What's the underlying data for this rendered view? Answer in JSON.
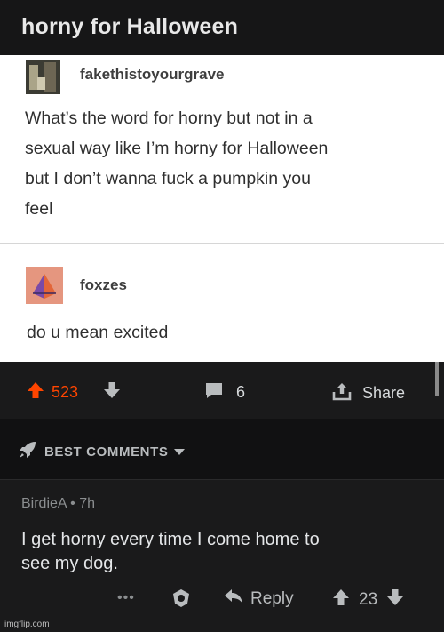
{
  "post": {
    "title": "horny for Halloween"
  },
  "tumblr": {
    "post1": {
      "username": "fakethistoyourgrave",
      "text_lines": [
        "What’s the word for horny but not in a",
        "sexual way like I’m horny for Halloween",
        "but I don’t wanna fuck a pumpkin you",
        "feel"
      ]
    },
    "post2": {
      "username": "foxzes",
      "text": "do u mean excited"
    }
  },
  "actionbar": {
    "upvotes": "523",
    "comments": "6",
    "share_label": "Share"
  },
  "sort": {
    "label": "BEST COMMENTS"
  },
  "comment": {
    "meta": "BirdieA • 7h",
    "text_lines": [
      "I get horny every time I come home to",
      "see my dog."
    ],
    "more": "•••",
    "reply_label": "Reply",
    "votes": "23"
  },
  "watermark": "imgflip.com",
  "colors": {
    "upvote": "#ff4500",
    "background": "#1a1a1b",
    "text": "#d7dadc"
  }
}
